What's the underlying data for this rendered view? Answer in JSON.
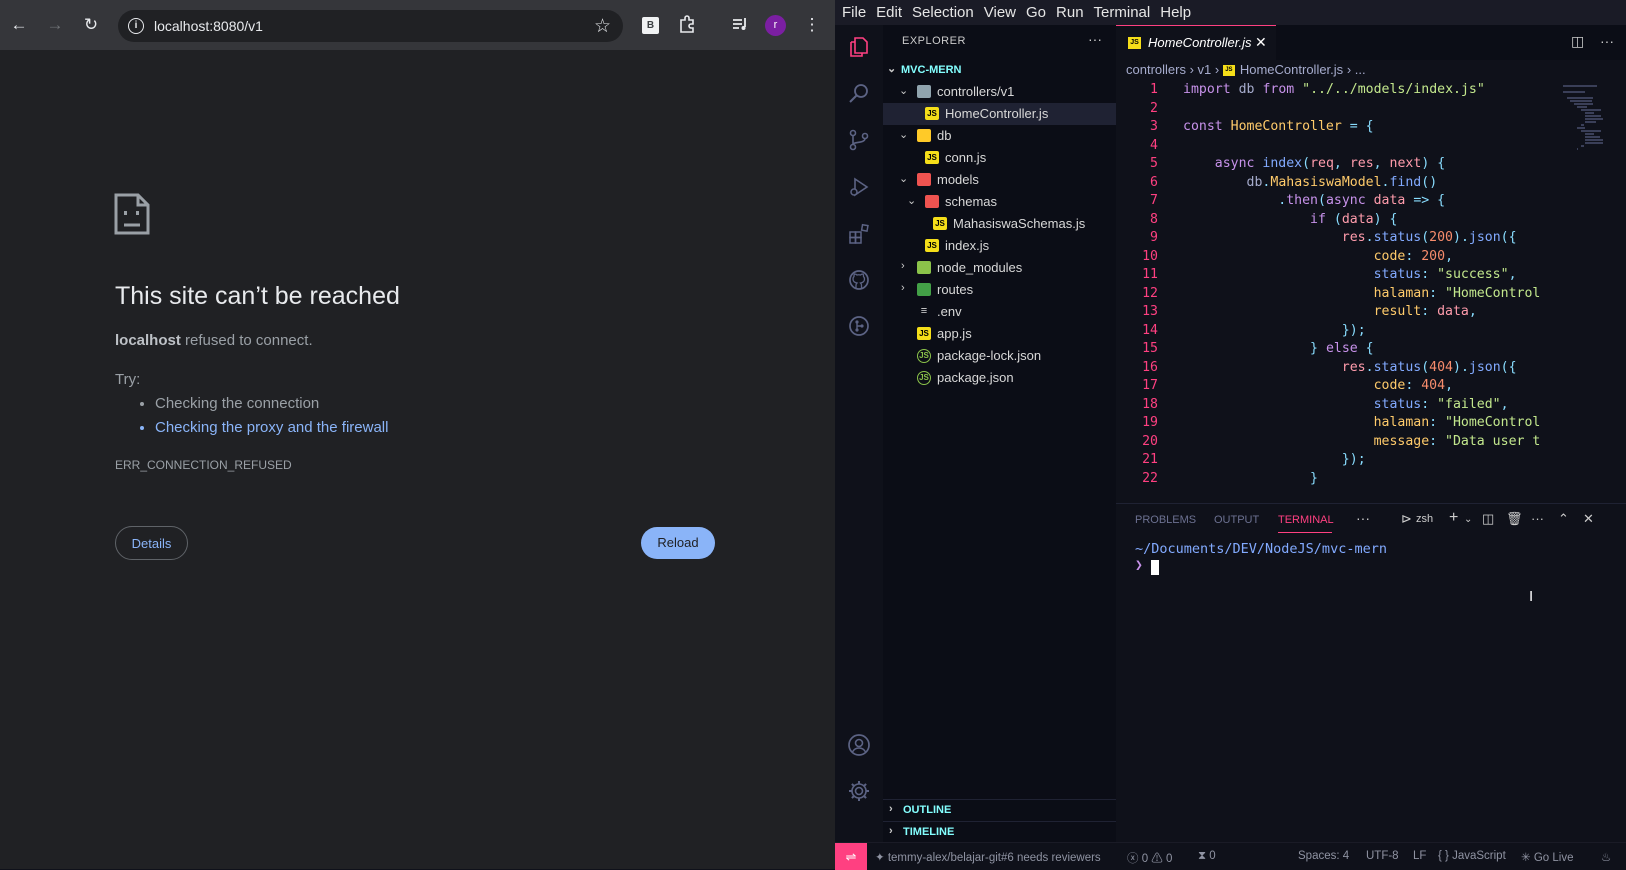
{
  "browser": {
    "url": "localhost:8080/v1",
    "profile_initial": "r",
    "extension_label": "B",
    "icons": [
      "back-arrow-icon",
      "forward-arrow-icon",
      "reload-icon",
      "info-icon",
      "star-icon",
      "extension-puzzle-icon",
      "media-control-icon",
      "kebab-menu-icon",
      "sad-page-icon"
    ],
    "error": {
      "title": "This site can’t be reached",
      "host": "localhost",
      "message": "refused to connect.",
      "try_label": "Try:",
      "suggestions": [
        "Checking the connection",
        "Checking the proxy and the firewall"
      ],
      "code": "ERR_CONNECTION_REFUSED",
      "details_button": "Details",
      "reload_button": "Reload"
    }
  },
  "vscode": {
    "menu": [
      "File",
      "Edit",
      "Selection",
      "View",
      "Go",
      "Run",
      "Terminal",
      "Help"
    ],
    "explorer": {
      "title": "EXPLORER",
      "more": "···",
      "project": "MVC-MERN",
      "tree": [
        {
          "name": "controllers/v1",
          "type": "folder-open"
        },
        {
          "name": "HomeController.js",
          "type": "js",
          "active": true
        },
        {
          "name": "db",
          "type": "folder-open"
        },
        {
          "name": "conn.js",
          "type": "js"
        },
        {
          "name": "models",
          "type": "folder-open"
        },
        {
          "name": "schemas",
          "type": "folder-open"
        },
        {
          "name": "MahasiswaSchemas.js",
          "type": "js"
        },
        {
          "name": "index.js",
          "type": "js"
        },
        {
          "name": "node_modules",
          "type": "folder"
        },
        {
          "name": "routes",
          "type": "folder"
        },
        {
          "name": ".env",
          "type": "env"
        },
        {
          "name": "app.js",
          "type": "js"
        },
        {
          "name": "package-lock.json",
          "type": "json"
        },
        {
          "name": "package.json",
          "type": "json"
        }
      ],
      "outline": "OUTLINE",
      "timeline": "TIMELINE"
    },
    "editor": {
      "tab_label": "HomeController.js",
      "breadcrumb": [
        "controllers",
        "v1",
        "HomeController.js",
        "..."
      ],
      "lines": [
        "import db from \"../../models/index.js\"",
        "",
        "const HomeController = {",
        "",
        "    async index(req, res, next) {",
        "        db.MahasiswaModel.find()",
        "            .then(async data => {",
        "                if (data) {",
        "                    res.status(200).json({",
        "                        code: 200,",
        "                        status: \"success\",",
        "                        halaman: \"HomeControl",
        "                        result: data,",
        "                    });",
        "                } else {",
        "                    res.status(404).json({",
        "                        code: 404,",
        "                        status: \"failed\",",
        "                        halaman: \"HomeControl",
        "                        message: \"Data user t",
        "                    });",
        "                }"
      ]
    },
    "panel": {
      "tabs": [
        "PROBLEMS",
        "OUTPUT",
        "TERMINAL"
      ],
      "active_tab": "TERMINAL",
      "more": "···",
      "shell": "zsh",
      "terminal_path": "~/Documents/DEV/NodeJS/mvc-mern",
      "prompt": "❯"
    },
    "status_bar": {
      "branch": "temmy-alex/belajar-git#6 needs reviewers",
      "errors": "0",
      "warnings": "0",
      "ports": "0",
      "spaces": "Spaces: 4",
      "encoding": "UTF-8",
      "eol": "LF",
      "language": "JavaScript",
      "golive": "Go Live"
    }
  }
}
